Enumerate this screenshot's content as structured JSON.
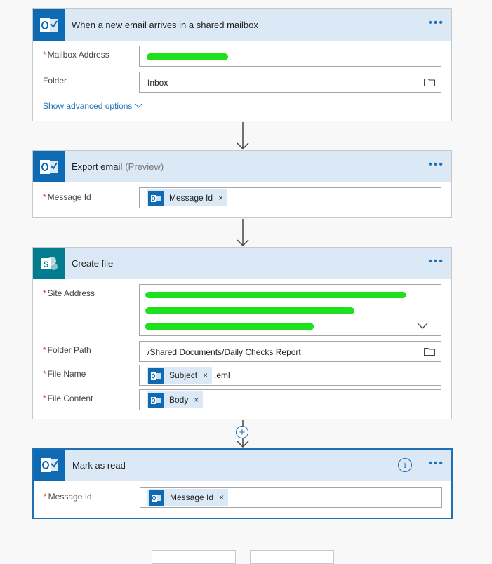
{
  "cards": [
    {
      "title": "When a new email arrives in a shared mailbox",
      "fields": [
        {
          "label": "Mailbox Address",
          "required": true,
          "value": ""
        },
        {
          "label": "Folder",
          "required": false,
          "value": "Inbox"
        }
      ],
      "advanced_link": "Show advanced options"
    },
    {
      "title": "Export email",
      "subtitle": "(Preview)",
      "fields": [
        {
          "label": "Message Id",
          "required": true,
          "token": "Message Id"
        }
      ]
    },
    {
      "title": "Create file",
      "fields": [
        {
          "label": "Site Address",
          "required": true,
          "value": ""
        },
        {
          "label": "Folder Path",
          "required": true,
          "value": "/Shared Documents/Daily Checks Report"
        },
        {
          "label": "File Name",
          "required": true,
          "token": "Subject",
          "suffix": ".eml"
        },
        {
          "label": "File Content",
          "required": true,
          "token": "Body"
        }
      ]
    },
    {
      "title": "Mark as read",
      "fields": [
        {
          "label": "Message Id",
          "required": true,
          "token": "Message Id"
        }
      ]
    }
  ],
  "ui": {
    "menu_glyph": "•••",
    "required_mark": "*",
    "remove_glyph": "×",
    "info_glyph": "i",
    "add_glyph": "+"
  },
  "colors": {
    "accent": "#1f6fb5",
    "outlook_icon": "#0f6ab4",
    "sharepoint_icon": "#047c8f",
    "header_bg": "#dbe9f6",
    "redaction": "#1ee11e"
  },
  "icons": [
    "outlook-icon",
    "sharepoint-icon",
    "folder-icon",
    "chevron-down-icon",
    "info-icon",
    "more-options-icon",
    "down-arrow-icon",
    "add-step-icon"
  ]
}
